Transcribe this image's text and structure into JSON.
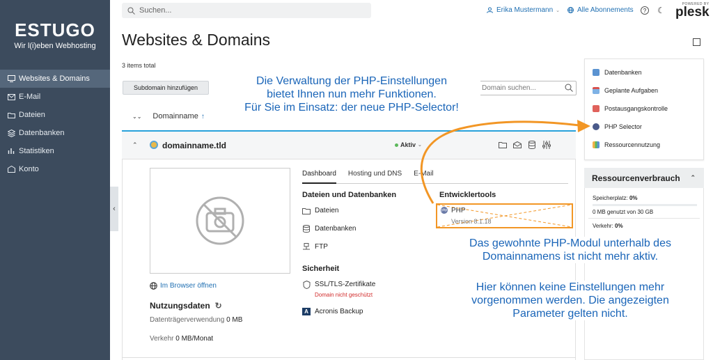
{
  "brand": {
    "name": "ESTUGO",
    "tagline": "Wir l(i)eben Webhosting"
  },
  "nav": {
    "items": [
      {
        "label": "Websites & Domains",
        "icon": "monitor-icon",
        "active": true
      },
      {
        "label": "E-Mail",
        "icon": "mail-icon"
      },
      {
        "label": "Dateien",
        "icon": "folder-icon"
      },
      {
        "label": "Datenbanken",
        "icon": "database-icon"
      },
      {
        "label": "Statistiken",
        "icon": "chart-icon"
      },
      {
        "label": "Konto",
        "icon": "account-icon"
      }
    ]
  },
  "header": {
    "search_placeholder": "Suchen...",
    "user_name": "Erika Mustermann",
    "subscriptions": "Alle Abonnements",
    "powered_by": "POWERED BY",
    "plesk": "plesk"
  },
  "page": {
    "title": "Websites & Domains",
    "items_total": "3 items total",
    "add_subdomain": "Subdomain hinzufügen",
    "domain_search_placeholder": "Domain suchen...",
    "col_domainname": "Domainname"
  },
  "domain": {
    "name": "domainname.tld",
    "status": "Aktiv",
    "open_in_browser": "Im Browser öffnen",
    "usage_title": "Nutzungsdaten",
    "disk_label": "Datenträgerverwendung",
    "disk_value": "0 MB",
    "traffic_label": "Verkehr",
    "traffic_value": "0 MB/Monat",
    "tabs": [
      "Dashboard",
      "Hosting und DNS",
      "E-Mail"
    ],
    "files_section": "Dateien und Datenbanken",
    "files_links": [
      "Dateien",
      "Datenbanken",
      "FTP"
    ],
    "security_section": "Sicherheit",
    "ssl": "SSL/TLS-Zertifikate",
    "ssl_warning": "Domain nicht geschützt",
    "acronis": "Acronis Backup",
    "dev_section": "Entwicklertools",
    "php_label": "PHP",
    "php_version": "Version 8.1.18"
  },
  "right_panel": {
    "links": [
      "Datenbanken",
      "Geplante Aufgaben",
      "Postausgangskontrolle",
      "PHP Selector",
      "Ressourcennutzung"
    ],
    "resources_title": "Ressourcenverbrauch",
    "storage_label": "Speicherplatz:",
    "storage_value": "0%",
    "storage_detail": "0 MB genutzt von 30 GB",
    "traffic_label": "Verkehr:",
    "traffic_value": "0%"
  },
  "annotations": {
    "top": [
      "Die Verwaltung der PHP-Einstellungen",
      "bietet Ihnen nun mehr Funktionen.",
      "Für Sie im Einsatz: der neue PHP-Selector!"
    ],
    "middle": [
      "Das gewohnte PHP-Modul unterhalb des",
      "Domainnamens ist nicht mehr aktiv."
    ],
    "bottom": [
      "Hier können keine Einstellungen mehr",
      "vorgenommen werden. Die angezeigten",
      "Parameter gelten nicht."
    ]
  },
  "colors": {
    "sidebar": "#3c4b5d",
    "accent": "#1f6fb2",
    "highlight": "#f29625",
    "annotation": "#1a65b8"
  }
}
